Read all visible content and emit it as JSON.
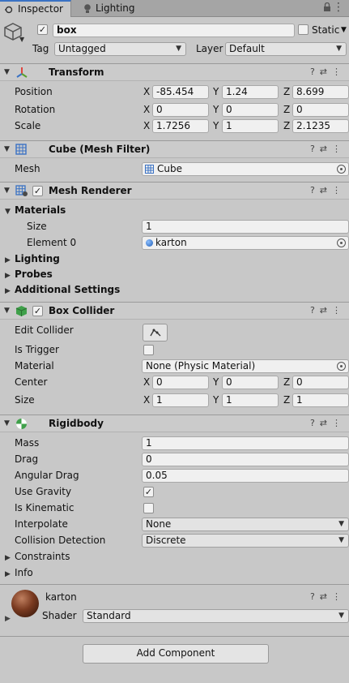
{
  "tabs": {
    "inspector": "Inspector",
    "lighting": "Lighting"
  },
  "object": {
    "name": "box",
    "static_label": "Static",
    "tag_label": "Tag",
    "tag_value": "Untagged",
    "layer_label": "Layer",
    "layer_value": "Default"
  },
  "transform": {
    "title": "Transform",
    "position": {
      "label": "Position",
      "x": "-85.454",
      "y": "1.24",
      "z": "8.699"
    },
    "rotation": {
      "label": "Rotation",
      "x": "0",
      "y": "0",
      "z": "0"
    },
    "scale": {
      "label": "Scale",
      "x": "1.7256",
      "y": "1",
      "z": "2.1235"
    }
  },
  "axes": {
    "x": "X",
    "y": "Y",
    "z": "Z"
  },
  "mesh_filter": {
    "title": "Cube (Mesh Filter)",
    "mesh_label": "Mesh",
    "mesh_value": "Cube"
  },
  "mesh_renderer": {
    "title": "Mesh Renderer",
    "materials_label": "Materials",
    "size_label": "Size",
    "size_value": "1",
    "element0_label": "Element 0",
    "element0_value": "karton",
    "lighting_label": "Lighting",
    "probes_label": "Probes",
    "additional_label": "Additional Settings"
  },
  "box_collider": {
    "title": "Box Collider",
    "edit_label": "Edit Collider",
    "trigger_label": "Is Trigger",
    "material_label": "Material",
    "material_value": "None (Physic Material)",
    "center": {
      "label": "Center",
      "x": "0",
      "y": "0",
      "z": "0"
    },
    "size": {
      "label": "Size",
      "x": "1",
      "y": "1",
      "z": "1"
    }
  },
  "rigidbody": {
    "title": "Rigidbody",
    "mass_label": "Mass",
    "mass_value": "1",
    "drag_label": "Drag",
    "drag_value": "0",
    "angular_label": "Angular Drag",
    "angular_value": "0.05",
    "gravity_label": "Use Gravity",
    "kinematic_label": "Is Kinematic",
    "interpolate_label": "Interpolate",
    "interpolate_value": "None",
    "collision_label": "Collision Detection",
    "collision_value": "Discrete",
    "constraints_label": "Constraints",
    "info_label": "Info"
  },
  "material": {
    "name": "karton",
    "shader_label": "Shader",
    "shader_value": "Standard"
  },
  "add_component": "Add Component",
  "colors": {
    "accent": "#3a72c4",
    "panel": "#c8c8c8",
    "header": "#cbcbcb"
  },
  "icons": [
    "inspector-icon",
    "lighting-icon",
    "lock-icon",
    "menu-icon",
    "cube-icon",
    "transform-icon",
    "mesh-filter-icon",
    "mesh-renderer-icon",
    "box-collider-icon",
    "rigidbody-icon",
    "help-icon",
    "preset-icon",
    "kebab-icon",
    "edit-collider-icon",
    "material-sphere-icon"
  ]
}
